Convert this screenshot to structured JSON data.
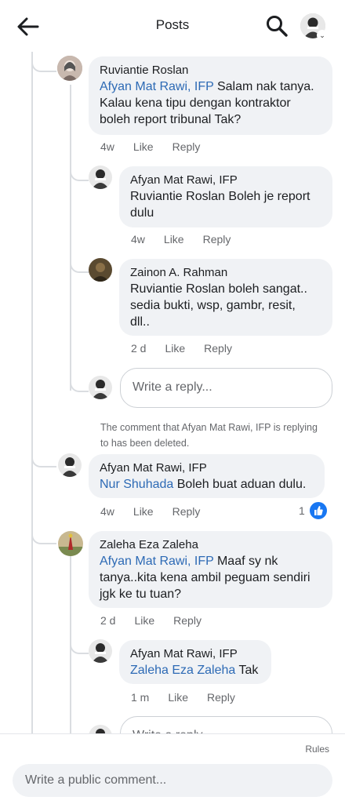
{
  "header": {
    "title": "Posts"
  },
  "comments": [
    {
      "author": "Ruviantie Roslan",
      "mention": "Afyan Mat Rawi, IFP",
      "text": " Salam nak tanya.",
      "text2": "Kalau kena tipu dengan kontraktor",
      "text3": "boleh report tribunal Tak?",
      "time": "4w",
      "like": "Like",
      "reply": "Reply"
    },
    {
      "author": "Afyan Mat Rawi, IFP",
      "text": "Ruviantie Roslan Boleh je report",
      "text2": "dulu",
      "time": "4w",
      "like": "Like",
      "reply": "Reply"
    },
    {
      "author": "Zainon A. Rahman",
      "text": "Ruviantie Roslan boleh sangat..",
      "text2": "sedia bukti, wsp, gambr, resit,",
      "text3": "dll..",
      "time": "2 d",
      "like": "Like",
      "reply": "Reply"
    },
    {
      "author": "Afyan Mat Rawi, IFP",
      "mention": "Nur Shuhada",
      "text": " Boleh buat aduan dulu.",
      "time": "4w",
      "like": "Like",
      "reply": "Reply",
      "like_count": "1"
    },
    {
      "author": "Zaleha Eza Zaleha",
      "mention": "Afyan Mat Rawi, IFP",
      "text": " Maaf sy nk",
      "text2": "tanya..kita kena ambil peguam sendiri",
      "text3": "jgk ke tu tuan?",
      "time": "2 d",
      "like": "Like",
      "reply": "Reply"
    },
    {
      "author": "Afyan Mat Rawi, IFP",
      "mention": "Zaleha Eza Zaleha",
      "text": " Tak",
      "time": "1 m",
      "like": "Like",
      "reply": "Reply"
    }
  ],
  "reply_placeholder": "Write a reply...",
  "deleted_note_1": "The comment that Afyan Mat Rawi, IFP is replying",
  "deleted_note_2": "to has been deleted.",
  "footer": {
    "rules": "Rules",
    "comment_placeholder": "Write a public comment..."
  }
}
